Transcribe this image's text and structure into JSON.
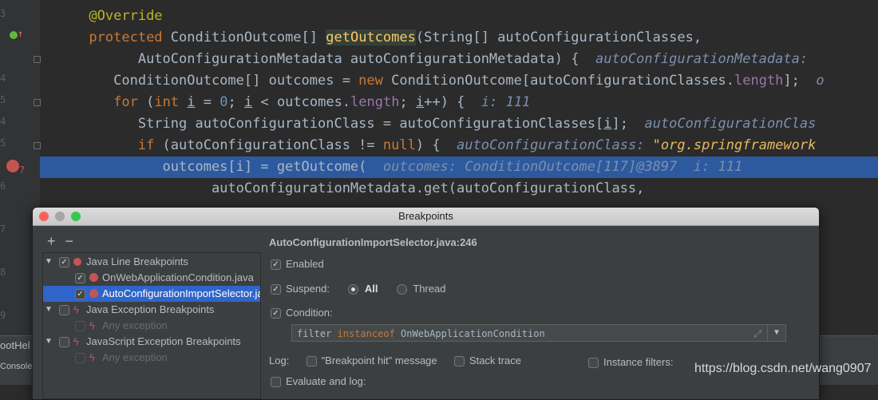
{
  "editor": {
    "gutter_numbers": [
      "3",
      "4",
      "5",
      "4",
      "5",
      "6",
      "7",
      "8",
      "9"
    ],
    "lines": [
      {
        "indent": "      ",
        "segments": [
          {
            "t": "@Override",
            "c": "ann"
          }
        ]
      },
      {
        "indent": "      ",
        "segments": [
          {
            "t": "protected ",
            "c": "kw"
          },
          {
            "t": "ConditionOutcome[] "
          },
          {
            "t": "getOutcomes",
            "c": "mhl"
          },
          {
            "t": "(String[] autoConfigurationClasses,"
          }
        ]
      },
      {
        "indent": "            ",
        "segments": [
          {
            "t": "AutoConfigurationMetadata autoConfigurationMetadata) {  "
          },
          {
            "t": "autoConfigurationMetadata: ",
            "c": "hint"
          }
        ]
      },
      {
        "indent": "         ",
        "segments": [
          {
            "t": "ConditionOutcome[] outcomes = "
          },
          {
            "t": "new ",
            "c": "kw"
          },
          {
            "t": "ConditionOutcome[autoConfigurationClasses."
          },
          {
            "t": "length",
            "c": "fld"
          },
          {
            "t": "];  "
          },
          {
            "t": "o",
            "c": "hint"
          }
        ]
      },
      {
        "indent": "         ",
        "segments": [
          {
            "t": "for ",
            "c": "kw"
          },
          {
            "t": "("
          },
          {
            "t": "int ",
            "c": "kw"
          },
          {
            "t": "i",
            "c": "und"
          },
          {
            "t": " = "
          },
          {
            "t": "0",
            "c": "num"
          },
          {
            "t": "; "
          },
          {
            "t": "i",
            "c": "und"
          },
          {
            "t": " < outcomes."
          },
          {
            "t": "length",
            "c": "fld"
          },
          {
            "t": "; "
          },
          {
            "t": "i",
            "c": "und"
          },
          {
            "t": "++) {  "
          },
          {
            "t": "i: 111",
            "c": "hint"
          }
        ]
      },
      {
        "indent": "            ",
        "segments": [
          {
            "t": "String autoConfigurationClass = autoConfigurationClasses["
          },
          {
            "t": "i",
            "c": "und"
          },
          {
            "t": "];  "
          },
          {
            "t": "autoConfigurationClas",
            "c": "hint"
          }
        ]
      },
      {
        "indent": "            ",
        "segments": [
          {
            "t": "if ",
            "c": "kw"
          },
          {
            "t": "(autoConfigurationClass != "
          },
          {
            "t": "null",
            "c": "kw"
          },
          {
            "t": ") {  "
          },
          {
            "t": "autoConfigurationClass: ",
            "c": "hint"
          },
          {
            "t": "\"org.springframework",
            "c": "str"
          }
        ]
      },
      {
        "indent": "               ",
        "hl": true,
        "segments": [
          {
            "t": "outcomes[i] = getOutcome(  "
          },
          {
            "t": "outcomes: ConditionOutcome[117]@3897  i: 111",
            "c": "hint"
          }
        ]
      },
      {
        "indent": "                     ",
        "segments": [
          {
            "t": "autoConfigurationMetadata.get(autoConfigurationClass,"
          }
        ]
      }
    ],
    "bottom_label": "ootHel",
    "console_label": "Console"
  },
  "dialog": {
    "title": "Breakpoints",
    "add_label": "+",
    "remove_label": "−",
    "tree": [
      {
        "label": "Java Line Breakpoints",
        "level": 0,
        "checked": true,
        "expanded": true,
        "icon": "red-dot-icon"
      },
      {
        "label": "OnWebApplicationCondition.java",
        "level": 1,
        "checked": true,
        "icon": "conditional-breakpoint-icon"
      },
      {
        "label": "AutoConfigurationImportSelector.java",
        "level": 1,
        "checked": true,
        "selected": true,
        "icon": "conditional-breakpoint-icon"
      },
      {
        "label": "Java Exception Breakpoints",
        "level": 0,
        "checked": false,
        "expanded": true,
        "icon": "lightning-icon"
      },
      {
        "label": "Any exception",
        "level": 1,
        "checked": false,
        "disabled": true,
        "icon": "lightning-icon"
      },
      {
        "label": "JavaScript Exception Breakpoints",
        "level": 0,
        "checked": false,
        "expanded": true,
        "icon": "lightning-icon"
      },
      {
        "label": "Any exception",
        "level": 1,
        "checked": false,
        "disabled": true,
        "icon": "lightning-icon"
      }
    ],
    "detail": {
      "title": "AutoConfigurationImportSelector.java:246",
      "enabled_label": "Enabled",
      "enabled": true,
      "suspend_label": "Suspend:",
      "suspend": true,
      "suspend_all_label": "All",
      "suspend_thread_label": "Thread",
      "suspend_policy": "All",
      "condition_label": "Condition:",
      "condition_checked": true,
      "condition_value_parts": [
        "filter ",
        "instanceof",
        " OnWebApplicationCondition"
      ],
      "log_label": "Log:",
      "log_message_label": "\"Breakpoint hit\" message",
      "log_message": false,
      "stack_trace_label": "Stack trace",
      "stack_trace": false,
      "evaluate_label": "Evaluate and log:",
      "evaluate": false,
      "instance_filters_label": "Instance filters:",
      "instance_filters": false
    }
  },
  "watermark": "https://blog.csdn.net/wang0907"
}
